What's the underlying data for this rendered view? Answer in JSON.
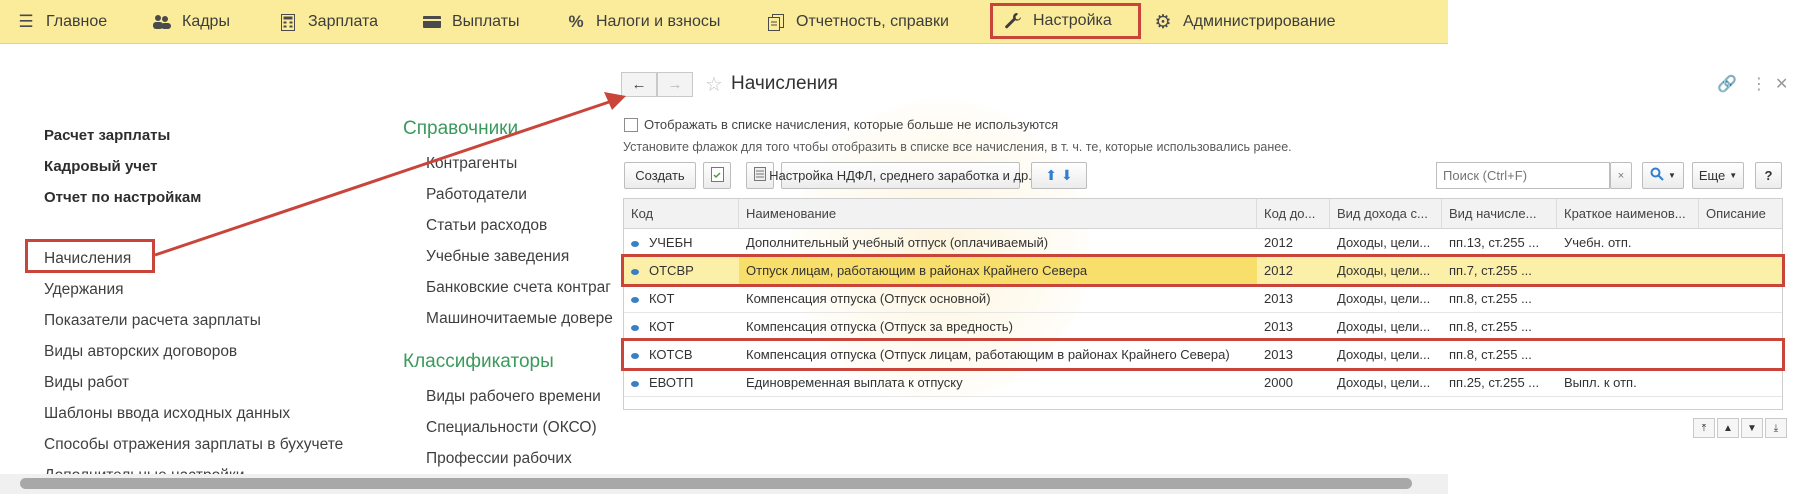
{
  "menu": {
    "items": [
      {
        "label": "Главное",
        "icon": "hamburger-icon"
      },
      {
        "label": "Кадры",
        "icon": "people-icon"
      },
      {
        "label": "Зарплата",
        "icon": "calculator-icon"
      },
      {
        "label": "Выплаты",
        "icon": "wallet-icon"
      },
      {
        "label": "Налоги и взносы",
        "icon": "percent-icon"
      },
      {
        "label": "Отчетность, справки",
        "icon": "report-icon"
      },
      {
        "label": "Настройка",
        "icon": "wrench-icon"
      },
      {
        "label": "Администрирование",
        "icon": "gear-icon"
      }
    ]
  },
  "left": {
    "bold_items": [
      "Расчет зарплаты",
      "Кадровый учет",
      "Отчет по настройкам"
    ],
    "items": [
      "Начисления",
      "Удержания",
      "Показатели расчета зарплаты",
      "Виды авторских договоров",
      "Виды работ",
      "Шаблоны ввода исходных данных",
      "Способы отражения зарплаты в бухучете",
      "Дополнительные настройки"
    ]
  },
  "middle": {
    "section1_title": "Справочники",
    "section1_items": [
      "Контрагенты",
      "Работодатели",
      "Статьи расходов",
      "Учебные заведения",
      "Банковские счета контраг",
      "Машиночитаемые довере"
    ],
    "section2_title": "Классификаторы",
    "section2_items": [
      "Виды рабочего времени",
      "Специальности (ОКСО)",
      "Профессии рабочих"
    ]
  },
  "form": {
    "title": "Начисления",
    "checkbox_label": "Отображать в списке начисления, которые больше не используются",
    "hint": "Установите флажок для того чтобы отобразить в списке все начисления, в т. ч. те, которые использовались ранее.",
    "create_label": "Создать",
    "ndfl_label": "Настройка НДФЛ, среднего заработка и др.",
    "search_placeholder": "Поиск (Ctrl+F)",
    "more_label": "Еще",
    "help_label": "?",
    "columns": [
      "Код",
      "Наименование",
      "Код до...",
      "Вид дохода с...",
      "Вид начисле...",
      "Краткое наименов...",
      "Описание"
    ],
    "rows": [
      [
        "УЧЕБН",
        "Дополнительный учебный отпуск (оплачиваемый)",
        "2012",
        "Доходы, цели...",
        "пп.13, ст.255 ...",
        "Учебн. отп.",
        ""
      ],
      [
        "ОТСВР",
        "Отпуск лицам, работающим в районах Крайнего Севера",
        "2012",
        "Доходы, цели...",
        "пп.7, ст.255 ...",
        "",
        ""
      ],
      [
        "КОТ",
        "Компенсация отпуска (Отпуск основной)",
        "2013",
        "Доходы, цели...",
        "пп.8, ст.255 ...",
        "",
        ""
      ],
      [
        "КОТ",
        "Компенсация отпуска (Отпуск за вредность)",
        "2013",
        "Доходы, цели...",
        "пп.8, ст.255 ...",
        "",
        ""
      ],
      [
        "КОТСВ",
        "Компенсация отпуска (Отпуск лицам, работающим в районах Крайнего Севера)",
        "2013",
        "Доходы, цели...",
        "пп.8, ст.255 ...",
        "",
        ""
      ],
      [
        "ЕВОТП",
        "Единовременная выплата к отпуску",
        "2000",
        "Доходы, цели...",
        "пп.25, ст.255 ...",
        "Выпл. к отп.",
        ""
      ]
    ]
  },
  "colors": {
    "menu_bg": "#fbec9b",
    "highlight": "#c9453a",
    "section_title": "#3a9a5c",
    "selected_row": "#fcefa8"
  }
}
